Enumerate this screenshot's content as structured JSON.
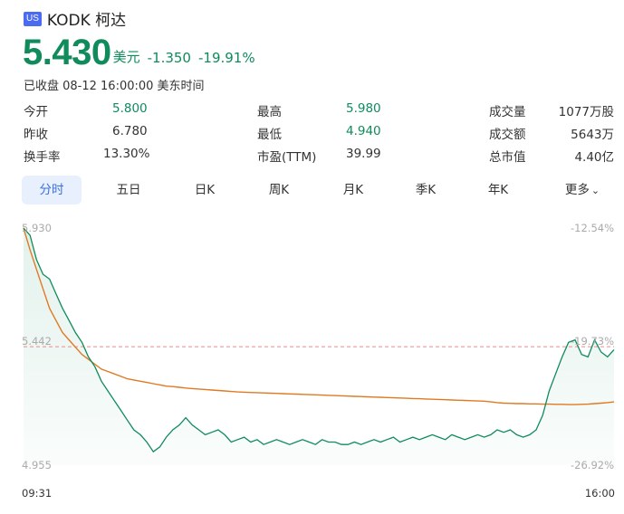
{
  "header": {
    "market_badge": "US",
    "ticker_name": "KODK 柯达"
  },
  "quote": {
    "price": "5.430",
    "currency": "美元",
    "change": "-1.350",
    "change_pct": "-19.91%",
    "close_info": "已收盘 08-12 16:00:00 美东时间",
    "color": "#0f8b5c"
  },
  "stats": [
    [
      {
        "label": "今开",
        "value": "5.800",
        "color": "green"
      },
      {
        "label": "最高",
        "value": "5.980",
        "color": "green"
      },
      {
        "label": "成交量",
        "value": "1077万股",
        "color": "dark"
      }
    ],
    [
      {
        "label": "昨收",
        "value": "6.780",
        "color": "dark"
      },
      {
        "label": "最低",
        "value": "4.940",
        "color": "green"
      },
      {
        "label": "成交额",
        "value": "5643万",
        "color": "dark"
      }
    ],
    [
      {
        "label": "换手率",
        "value": "13.30%",
        "color": "dark"
      },
      {
        "label": "市盈(TTM)",
        "value": "39.99",
        "color": "dark"
      },
      {
        "label": "总市值",
        "value": "4.40亿",
        "color": "dark"
      }
    ]
  ],
  "tabs": [
    {
      "label": "分时",
      "active": true
    },
    {
      "label": "五日"
    },
    {
      "label": "日K"
    },
    {
      "label": "周K"
    },
    {
      "label": "月K"
    },
    {
      "label": "季K"
    },
    {
      "label": "年K"
    },
    {
      "label": "更多"
    }
  ],
  "chart_data": {
    "type": "line",
    "y_left_labels": [
      "5.930",
      "5.442",
      "4.955"
    ],
    "y_right_labels": [
      "-12.54%",
      "-19.73%",
      "-26.92%"
    ],
    "x_labels": [
      "09:31",
      "16:00"
    ],
    "ylim": [
      4.955,
      5.93
    ],
    "reference_price": 5.442,
    "series": [
      {
        "color": "#0f8b5c",
        "values": [
          5.93,
          5.9,
          5.8,
          5.74,
          5.72,
          5.66,
          5.6,
          5.55,
          5.5,
          5.46,
          5.4,
          5.36,
          5.3,
          5.26,
          5.22,
          5.18,
          5.14,
          5.1,
          5.08,
          5.05,
          5.01,
          5.03,
          5.07,
          5.1,
          5.12,
          5.15,
          5.12,
          5.1,
          5.08,
          5.09,
          5.1,
          5.08,
          5.05,
          5.06,
          5.07,
          5.05,
          5.06,
          5.04,
          5.05,
          5.06,
          5.05,
          5.04,
          5.05,
          5.06,
          5.05,
          5.04,
          5.06,
          5.05,
          5.05,
          5.04,
          5.04,
          5.05,
          5.04,
          5.05,
          5.06,
          5.05,
          5.06,
          5.07,
          5.05,
          5.06,
          5.07,
          5.06,
          5.07,
          5.08,
          5.07,
          5.06,
          5.08,
          5.07,
          5.06,
          5.07,
          5.08,
          5.07,
          5.08,
          5.1,
          5.09,
          5.1,
          5.08,
          5.07,
          5.08,
          5.1,
          5.16,
          5.26,
          5.33,
          5.4,
          5.46,
          5.47,
          5.41,
          5.4,
          5.47,
          5.42,
          5.4,
          5.43
        ],
        "stroke_color": "#0f8b5c"
      },
      {
        "color": "#e07a22",
        "values": [
          5.93,
          5.84,
          5.76,
          5.68,
          5.6,
          5.55,
          5.5,
          5.47,
          5.44,
          5.41,
          5.39,
          5.37,
          5.35,
          5.34,
          5.33,
          5.32,
          5.31,
          5.305,
          5.3,
          5.295,
          5.29,
          5.285,
          5.28,
          5.278,
          5.275,
          5.272,
          5.27,
          5.268,
          5.266,
          5.264,
          5.262,
          5.26,
          5.258,
          5.256,
          5.255,
          5.254,
          5.253,
          5.252,
          5.251,
          5.25,
          5.249,
          5.248,
          5.247,
          5.246,
          5.245,
          5.244,
          5.243,
          5.242,
          5.241,
          5.24,
          5.239,
          5.238,
          5.237,
          5.236,
          5.235,
          5.234,
          5.233,
          5.232,
          5.231,
          5.23,
          5.229,
          5.228,
          5.227,
          5.226,
          5.225,
          5.224,
          5.223,
          5.222,
          5.221,
          5.22,
          5.219,
          5.218,
          5.215,
          5.212,
          5.21,
          5.209,
          5.208,
          5.208,
          5.207,
          5.207,
          5.206,
          5.206,
          5.205,
          5.205,
          5.204,
          5.204,
          5.205,
          5.206,
          5.208,
          5.21,
          5.212,
          5.215
        ],
        "stroke_color": "#e07a22"
      }
    ]
  }
}
